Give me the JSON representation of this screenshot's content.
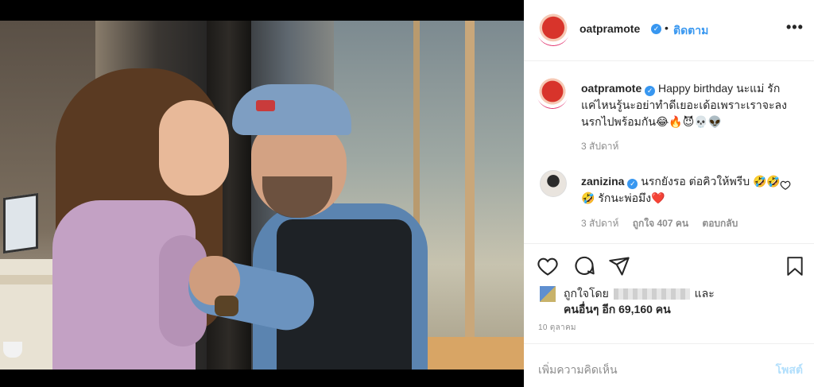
{
  "post": {
    "username": "oatpramote",
    "verified_glyph": "✓",
    "dot": "•",
    "follow_label": "ติดตาม",
    "more_glyph": "•••",
    "caption_text": "Happy birthday นะแม่ รักแค่ไหนรู้นะอย่าทำดีเยอะเด้อเพราะเราจะลงนรกไปพร้อมกัน😂🔥😈💀👽",
    "caption_time": "3 สัปดาห์",
    "comment": {
      "username": "zanizina",
      "text": "นรกยังรอ ต่อคิวให้พรีบ 🤣🤣🤣 รักนะพ่อมึง❤️",
      "time": "3 สัปดาห์",
      "likes": "ถูกใจ 407 คน",
      "reply": "ตอบกลับ"
    },
    "likes": {
      "prefix": "ถูกใจโดย",
      "suffix": "และ",
      "others": "คนอื่นๆ อีก 69,160 คน"
    },
    "date": "10 ตุลาคม",
    "composer": {
      "placeholder": "เพิ่มความคิดเห็น",
      "post_label": "โพสต์"
    }
  },
  "icons": [
    "avatar",
    "verified-badge",
    "more-options-icon",
    "heart-icon",
    "comment-icon",
    "share-icon",
    "bookmark-icon"
  ],
  "colors": {
    "link_blue": "#3897f0",
    "muted": "#8e8e8e",
    "text": "#262626",
    "post_disabled": "#b2dffc"
  }
}
